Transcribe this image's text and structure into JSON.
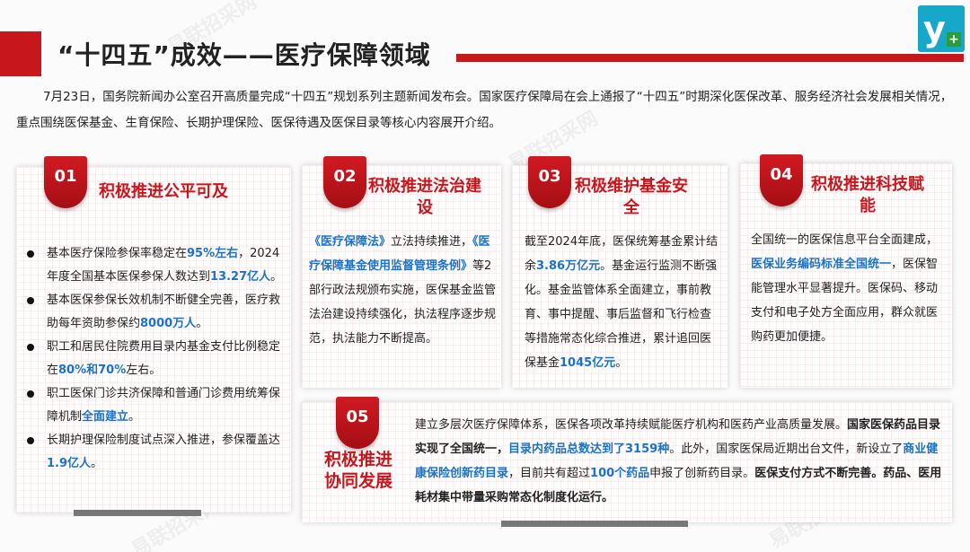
{
  "header": {
    "title": "“十四五”成效——医疗保障领域"
  },
  "intro": "7月23日，国务院新闻办公室召开高质量完成“十四五”规划系列主题新闻发布会。国家医疗保障局在会上通报了“十四五”时期深化医保改革、服务经济社会发展相关情况，重点围绕医保基金、生育保险、长期护理保险、医保待遇及医保目录等核心内容展开介绍。",
  "watermark": "易联招采网",
  "cards": [
    {
      "num": "01",
      "title": "积极推进公平可及",
      "bullets": [
        {
          "a": "基本医疗保险参保率稳定在",
          "h": "95%左右",
          "b": "，2024年度全国基本医保参保人数达到",
          "h2": "13.27亿人",
          "c": "。"
        },
        {
          "a": "基本医保参保长效机制不断健全完善，医疗救助每年资助参保约",
          "h": "8000万人",
          "b": "。"
        },
        {
          "a": "职工和居民住院费用目录内基金支付比例稳定在",
          "h": "80%和70%",
          "b": "左右。"
        },
        {
          "a": "职工医保门诊共济保障和普通门诊费用统筹保障机制",
          "h": "全面建立",
          "b": "。"
        },
        {
          "a": "长期护理保险制度试点深入推进，参保覆盖达",
          "h": "1.9亿人",
          "b": "。"
        }
      ]
    },
    {
      "num": "02",
      "title": "积极推进法治建设",
      "h1": "《医疗保障法》",
      "t1": "立法持续推进，",
      "h2": "《医疗保障基金使用监督管理条例》",
      "t2": "等2部行政法规颁布实施，医保基金监管法治建设持续强化，执法程序逐步规范，执法能力不断提高。"
    },
    {
      "num": "03",
      "title": "积极维护基金安全",
      "t1": "截至2024年底，医保统筹基金累计结余",
      "h1": "3.86万亿元",
      "t2": "。基金运行监测不断强化。基金监管体系全面建立，事前教育、事中提醒、事后监督和飞行检查等措施常态化综合推进，累计追回医保基金",
      "h2": "1045亿元",
      "t3": "。"
    },
    {
      "num": "04",
      "title": "积极推进科技赋能",
      "t1": "全国统一的医保信息平台全面建成，",
      "h1": "医保业务编码标准全国统一",
      "t2": "，医保智能管理水平显著提升。医保码、移动支付和电子处方全面应用，群众就医购药更加便捷。"
    },
    {
      "num": "05",
      "title": "积极推进协同发展",
      "t1": "建立多层次医疗保障体系，医保各项改革持续赋能医疗机构和医药产业高质量发展。",
      "s1": "国家医保药品目录实现了全国统一，",
      "h1": "目录内药品总数达到了3159种",
      "t2": "。此外，国家医保局近期出台文件，新设立了",
      "h2": "商业健康保险创新药目录",
      "t3": "，目前共有超过",
      "h3": "100个药品",
      "t4": "申报了创新药目录。",
      "s2": "医保支付方式不断完善。药品、医用耗材集中带量采购常态化制度化运行。"
    }
  ],
  "colors": {
    "accent": "#c8161d",
    "highlight": "#1a73c8",
    "logo": "#17a8c9"
  }
}
